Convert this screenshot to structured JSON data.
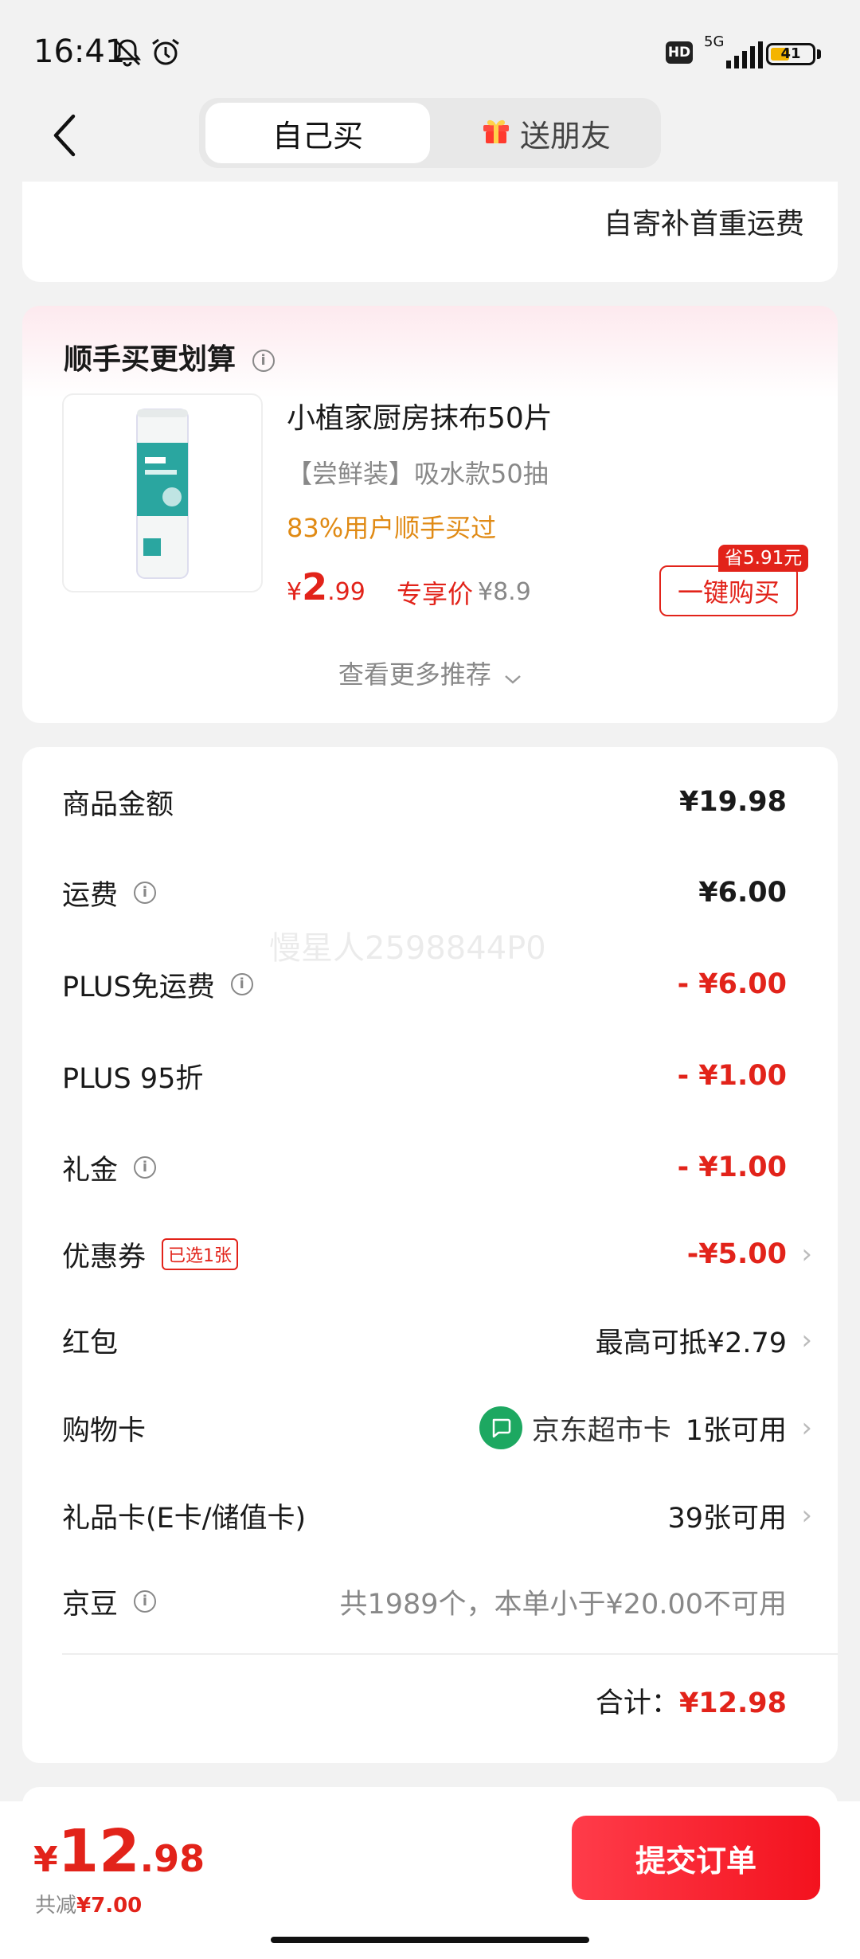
{
  "status_bar": {
    "time": "16:41",
    "network": "5G",
    "hd": "HD",
    "battery": "41",
    "battery_level": 0.41
  },
  "top_nav": {
    "tabs": [
      {
        "label": "自己买",
        "active": true
      },
      {
        "label": "送朋友",
        "active": false,
        "icon": "gift-icon"
      }
    ]
  },
  "shipping_card": {
    "note": "自寄补首重运费"
  },
  "recommend": {
    "title": "顺手买更划算",
    "product": {
      "name": "小植家厨房抹布50片",
      "spec": "【尝鲜装】吸水款50抽",
      "buyers": "83%用户顺手买过",
      "price_symbol": "¥",
      "price_int": "2",
      "price_dec": ".99",
      "price_tag": "专享价",
      "orig_price": "¥8.9",
      "save_badge": "省5.91元",
      "buy_label": "一键购买"
    },
    "more_label": "查看更多推荐"
  },
  "summary": {
    "rows": [
      {
        "label": "商品金额",
        "value": "¥19.98"
      },
      {
        "label": "运费",
        "value": "¥6.00"
      },
      {
        "label": "PLUS免运费",
        "value": "- ¥6.00"
      },
      {
        "label": "PLUS 95折",
        "value": "- ¥1.00"
      },
      {
        "label": "礼金",
        "value": "- ¥1.00"
      },
      {
        "label": "优惠券",
        "badge": "已选1张",
        "value": "-¥5.00"
      },
      {
        "label": "红包",
        "value": "最高可抵¥2.79"
      },
      {
        "label": "购物卡",
        "card_name": "京东超市卡",
        "value": "1张可用"
      },
      {
        "label": "礼品卡(E卡/储值卡)",
        "value": "39张可用"
      },
      {
        "label": "京豆",
        "value": "共1989个，本单小于¥20.00不可用"
      }
    ],
    "total_label": "合计：",
    "total_value": "¥12.98"
  },
  "watermark": "慢星人2598844P0",
  "bottom_bar": {
    "price_symbol": "¥",
    "price_int": "12",
    "price_dec": ".98",
    "save_label": "共减",
    "save_value": "¥7.00",
    "submit_label": "提交订单"
  },
  "colors": {
    "accent": "#e2231a",
    "orange": "#e08a14",
    "green": "#1da861"
  }
}
